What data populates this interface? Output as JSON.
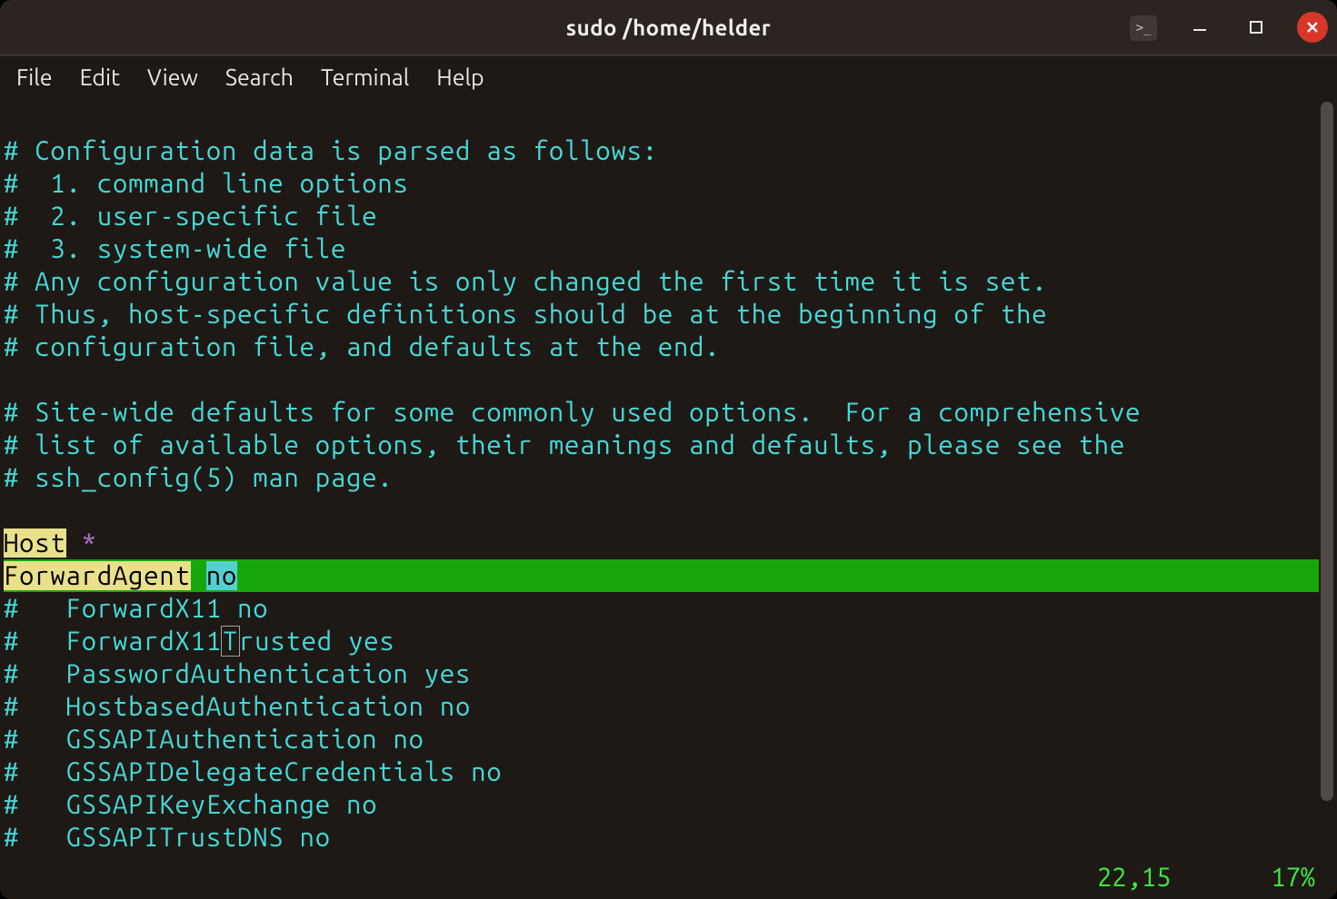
{
  "window": {
    "title": "sudo  /home/helder"
  },
  "menu": {
    "items": [
      "File",
      "Edit",
      "View",
      "Search",
      "Terminal",
      "Help"
    ]
  },
  "editor": {
    "lines": [
      {
        "text": "",
        "type": "blank"
      },
      {
        "text": "# Configuration data is parsed as follows:",
        "type": "comment"
      },
      {
        "text": "#  1. command line options",
        "type": "comment"
      },
      {
        "text": "#  2. user-specific file",
        "type": "comment"
      },
      {
        "text": "#  3. system-wide file",
        "type": "comment"
      },
      {
        "text": "# Any configuration value is only changed the first time it is set.",
        "type": "comment"
      },
      {
        "text": "# Thus, host-specific definitions should be at the beginning of the",
        "type": "comment"
      },
      {
        "text": "# configuration file, and defaults at the end.",
        "type": "comment"
      },
      {
        "text": "",
        "type": "blank"
      },
      {
        "text": "# Site-wide defaults for some commonly used options.  For a comprehensive",
        "type": "comment"
      },
      {
        "text": "# list of available options, their meanings and defaults, please see the",
        "type": "comment"
      },
      {
        "text": "# ssh_config(5) man page.",
        "type": "comment"
      },
      {
        "text": "",
        "type": "blank"
      },
      {
        "text": "Host *",
        "type": "host"
      },
      {
        "text": "ForwardAgent no",
        "type": "cursor",
        "keyword": "ForwardAgent",
        "value": "no"
      },
      {
        "text": "#   ForwardX11 no",
        "type": "comment"
      },
      {
        "text": "#   ForwardX11Trusted yes",
        "type": "comment"
      },
      {
        "text": "#   PasswordAuthentication yes",
        "type": "comment"
      },
      {
        "text": "#   HostbasedAuthentication no",
        "type": "comment"
      },
      {
        "text": "#   GSSAPIAuthentication no",
        "type": "comment"
      },
      {
        "text": "#   GSSAPIDelegateCredentials no",
        "type": "comment"
      },
      {
        "text": "#   GSSAPIKeyExchange no",
        "type": "comment"
      },
      {
        "text": "#   GSSAPITrustDNS no",
        "type": "comment"
      }
    ]
  },
  "status": {
    "position": "22,15",
    "percent": "17%"
  }
}
